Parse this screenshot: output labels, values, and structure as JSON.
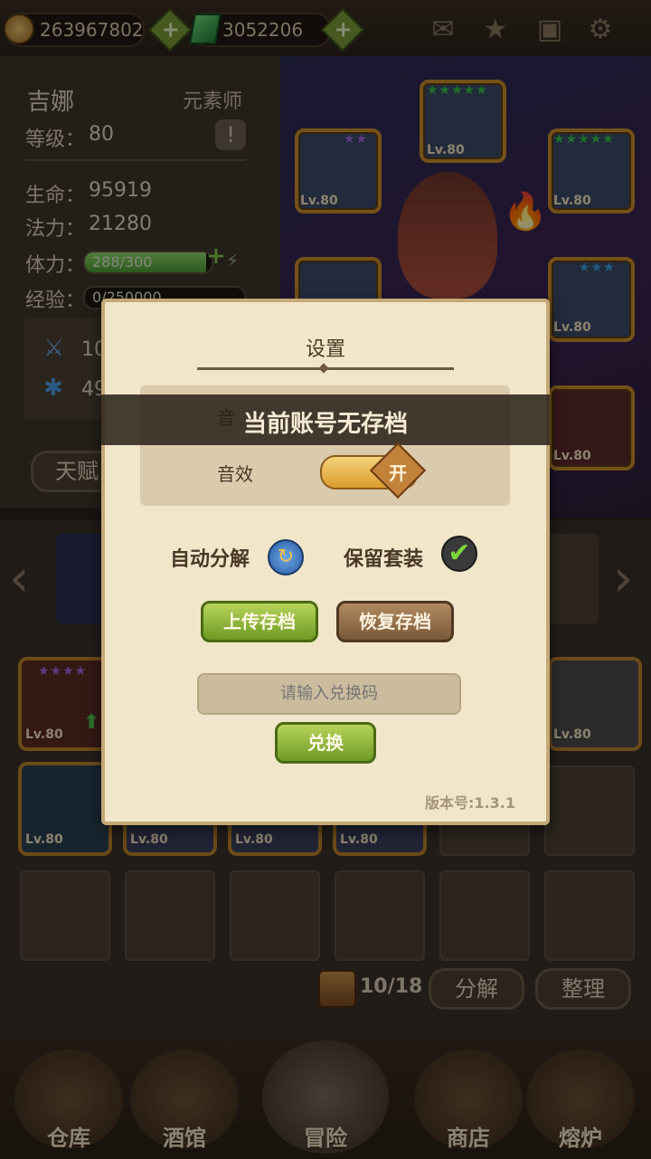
{
  "top_bar": {
    "gold": "263967802",
    "gems": "3052206",
    "icons": [
      "mail-icon",
      "star-badge-icon",
      "save-icon",
      "gear-icon"
    ]
  },
  "character": {
    "name": "吉娜",
    "class": "元素师",
    "level_label": "等级：",
    "level": "80",
    "hp_label": "生命：",
    "hp": "95919",
    "mp_label": "法力：",
    "mp": "21280",
    "stamina_label": "体力：",
    "stamina_text": "288/300",
    "stamina_fraction": 0.96,
    "exp_label": "经验：",
    "exp_text": "0/250000",
    "stat1_partial": "10",
    "stat2_partial": "49",
    "talent_label": "天赋"
  },
  "equipment": [
    {
      "level": "Lv.80"
    },
    {
      "level": "Lv.80"
    },
    {
      "level": "Lv.80"
    },
    {
      "level": "Lv.80"
    },
    {
      "level": "Lv.80"
    }
  ],
  "inventory": {
    "row1_levels": [
      "Lv.80",
      "Lv.80"
    ],
    "row2_levels": [
      "Lv.80",
      "Lv.80",
      "Lv.80",
      "Lv.80"
    ],
    "count": "10/18",
    "decompose_label": "分解",
    "sort_label": "整理"
  },
  "bottom_nav": [
    {
      "label": "仓库"
    },
    {
      "label": "酒馆"
    },
    {
      "label": "冒险"
    },
    {
      "label": "商店"
    },
    {
      "label": "熔炉"
    }
  ],
  "settings_modal": {
    "title": "设置",
    "banner": "当前账号无存档",
    "music_partial": "音",
    "sound_label": "音效",
    "sound_toggle": "开",
    "auto_decompose_label": "自动分解",
    "keep_set_label": "保留套装",
    "upload_label": "上传存档",
    "restore_label": "恢复存档",
    "redeem_placeholder": "请输入兑换码",
    "redeem_button": "兑换",
    "version": "版本号:1.3.1"
  },
  "colors": {
    "accent_green": "#7a9a3a",
    "modal_bg": "#f1e6c9",
    "frame_gold": "#c68c2a"
  }
}
